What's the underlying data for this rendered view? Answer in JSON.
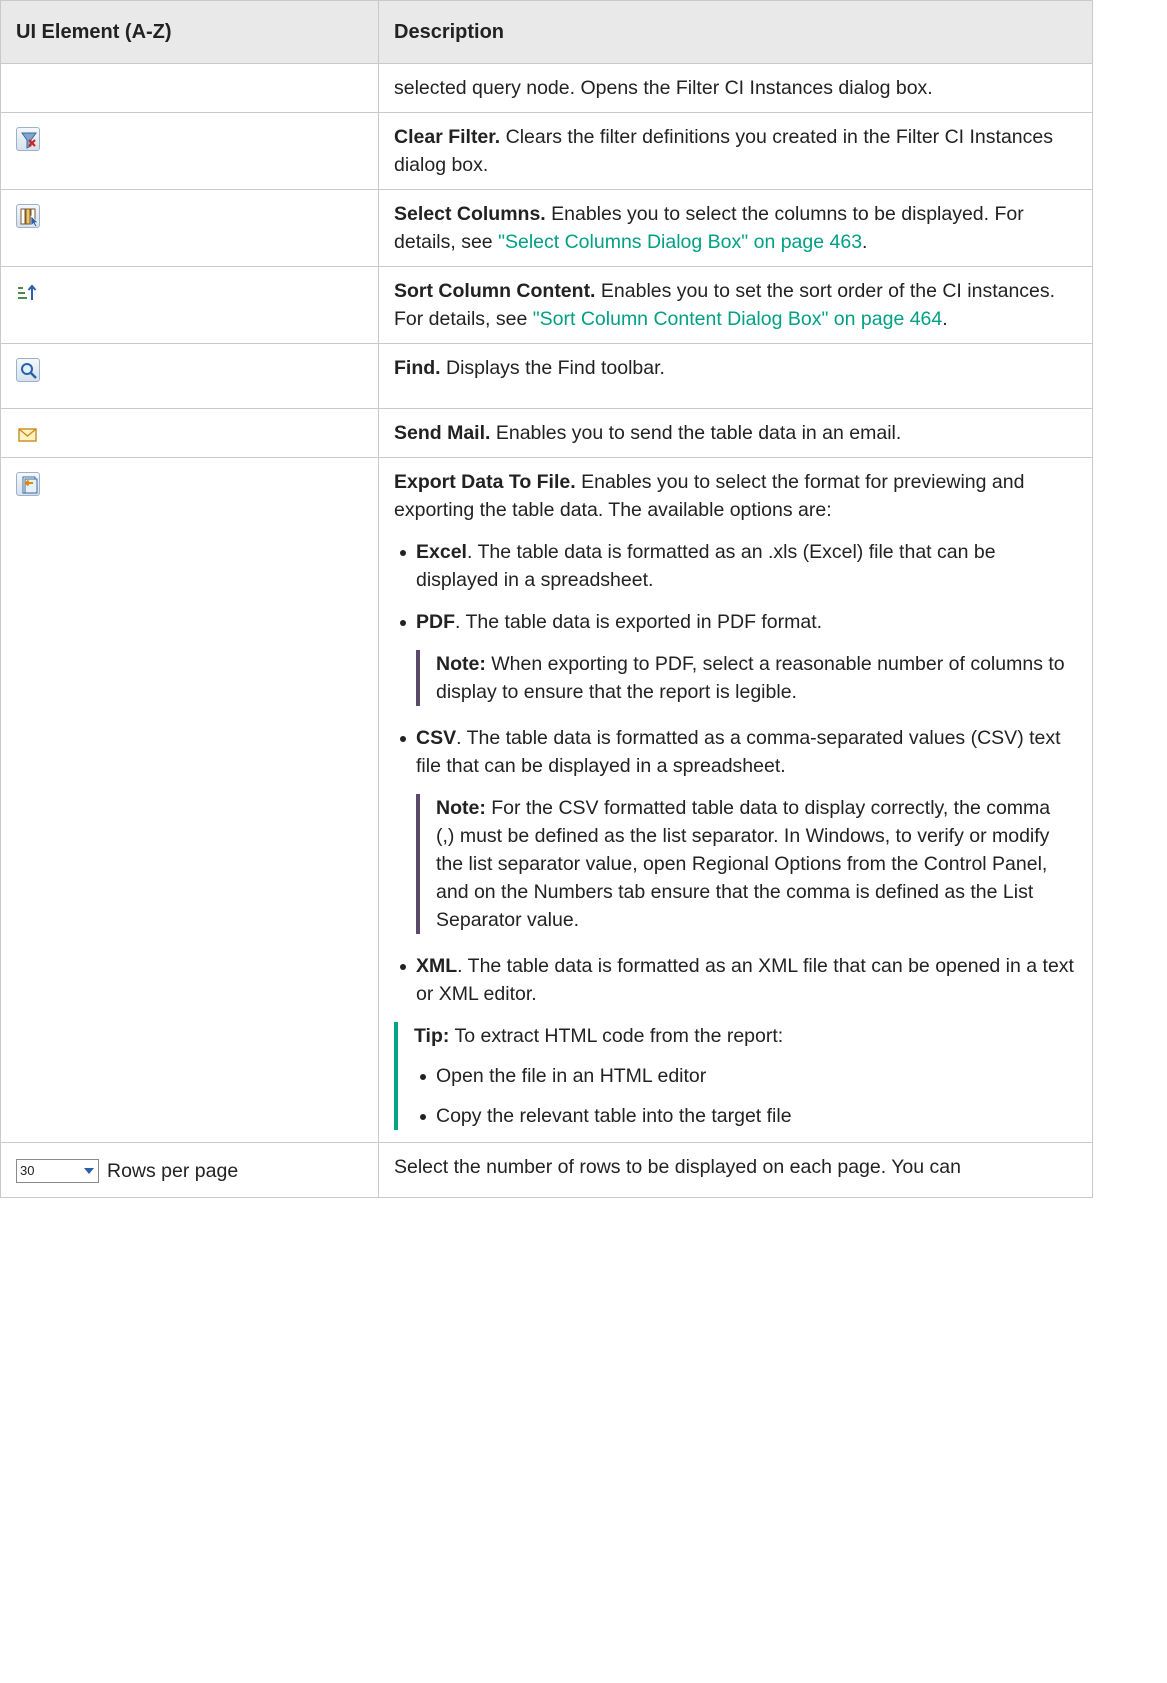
{
  "header": {
    "col1": "UI Element (A-Z)",
    "col2": "Description"
  },
  "rows": {
    "cont": {
      "text": "selected query node. Opens the Filter CI Instances dialog box."
    },
    "clear_filter": {
      "icon": "clear-filter-icon",
      "title": "Clear Filter.",
      "text": " Clears the filter definitions you created in the Filter CI Instances dialog box."
    },
    "select_columns": {
      "icon": "select-columns-icon",
      "title": "Select Columns.",
      "text": " Enables you to select the columns to be displayed. For details, see ",
      "link": "\"Select Columns Dialog Box\" on page 463",
      "end": "."
    },
    "sort_column": {
      "icon": "sort-ascending-icon",
      "title": "Sort Column Content.",
      "text": " Enables you to set the sort order of the CI instances. For details, see ",
      "link": "\"Sort Column Content Dialog Box\" on page 464",
      "end": "."
    },
    "find": {
      "icon": "search-icon",
      "title": "Find.",
      "text": " Displays the Find toolbar."
    },
    "send_mail": {
      "icon": "mail-icon",
      "title": "Send Mail.",
      "text": " Enables you to send the table data in an email."
    },
    "export": {
      "icon": "export-icon",
      "title": "Export Data To File.",
      "text": " Enables you to select the format for previewing and exporting the table data. The available options are:",
      "options": [
        {
          "name": "Excel",
          "text": ". The table data is formatted as an .xls (Excel) file that can be displayed in a spreadsheet."
        },
        {
          "name": "PDF",
          "text": ". The table data is exported in PDF format."
        },
        {
          "name": "CSV",
          "text": ". The table data is formatted as a comma-separated values (CSV) text file that can be displayed in a spreadsheet."
        },
        {
          "name": "XML",
          "text": ". The table data is formatted as an XML file that can be opened in a text or XML editor."
        }
      ],
      "pdf_note": {
        "label": "Note:",
        "text": " When exporting to PDF, select a reasonable number of columns to display to ensure that the report is legible."
      },
      "csv_note": {
        "label": "Note:",
        "text": " For the CSV formatted table data to display correctly, the comma (,) must be defined as the list separator. In Windows, to verify or modify the list separator value, open Regional Options from the Control Panel, and on the Numbers tab ensure that the comma is defined as the List Separator value."
      },
      "tip": {
        "label": "Tip:",
        "text": " To extract HTML code from the report:",
        "items": [
          "Open the file in an HTML editor",
          "Copy the relevant table into the target file"
        ]
      }
    },
    "rows_per_page": {
      "select_value": "30",
      "label": "Rows per page",
      "text": "Select the number of rows to be displayed on each page. You can"
    }
  }
}
